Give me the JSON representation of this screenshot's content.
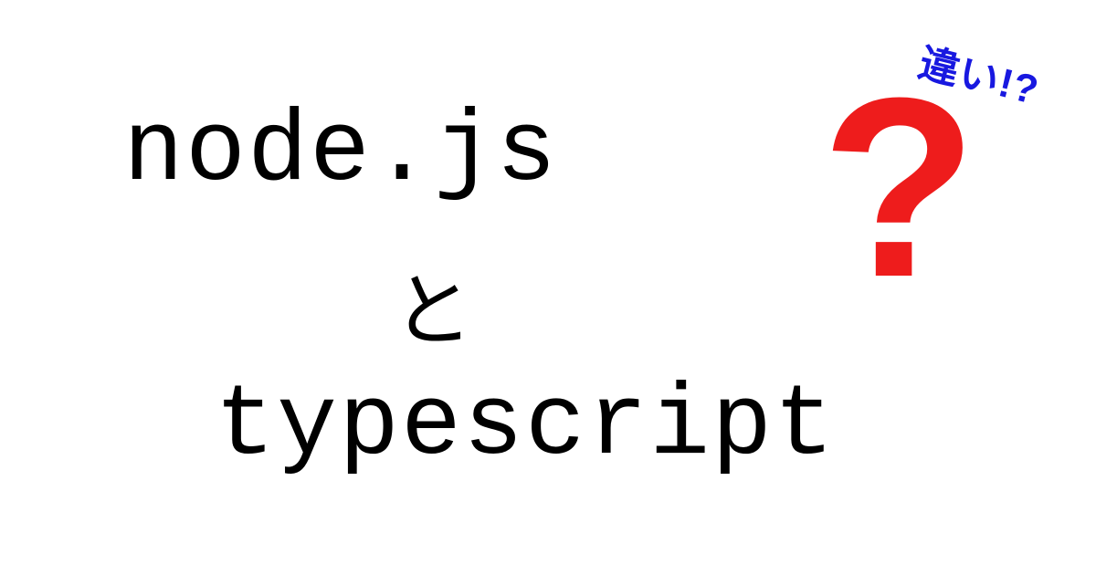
{
  "text": {
    "line1": "node.js",
    "line2": "と",
    "line3": "typescript"
  },
  "decoration": {
    "question_mark": "?",
    "callout_text": "違い!?"
  },
  "colors": {
    "primary_text": "#000000",
    "accent_red": "#ee1c1c",
    "accent_blue": "#1818e0",
    "background": "#ffffff"
  }
}
